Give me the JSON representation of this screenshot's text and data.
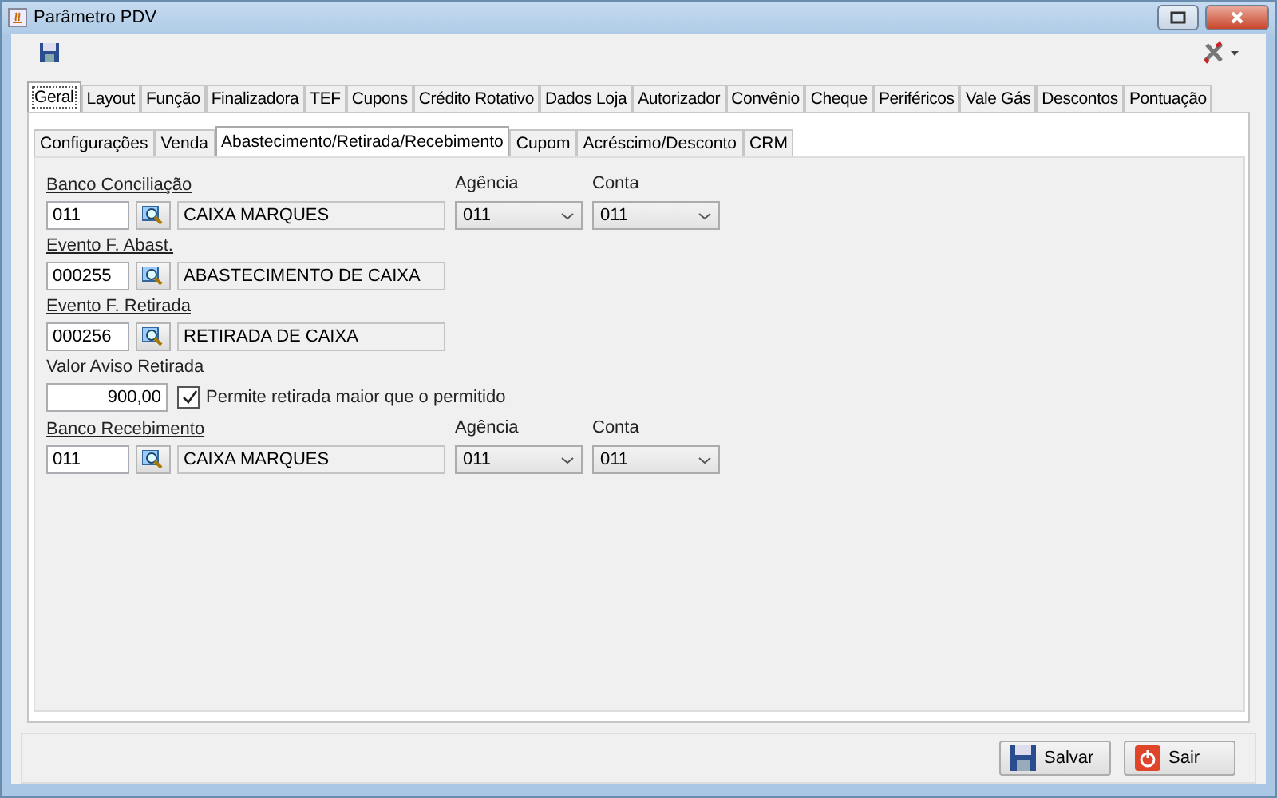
{
  "window": {
    "title": "Parâmetro PDV"
  },
  "main_tabs": [
    {
      "label": "Geral",
      "selected": true
    },
    {
      "label": "Layout",
      "selected": false
    },
    {
      "label": "Função",
      "selected": false
    },
    {
      "label": "Finalizadora",
      "selected": false
    },
    {
      "label": "TEF",
      "selected": false
    },
    {
      "label": "Cupons",
      "selected": false
    },
    {
      "label": "Crédito Rotativo",
      "selected": false
    },
    {
      "label": "Dados Loja",
      "selected": false
    },
    {
      "label": "Autorizador",
      "selected": false
    },
    {
      "label": "Convênio",
      "selected": false
    },
    {
      "label": "Cheque",
      "selected": false
    },
    {
      "label": "Periféricos",
      "selected": false
    },
    {
      "label": "Vale Gás",
      "selected": false
    },
    {
      "label": "Descontos",
      "selected": false
    },
    {
      "label": "Pontuação",
      "selected": false
    }
  ],
  "sub_tabs": [
    {
      "label": "Configurações",
      "selected": false
    },
    {
      "label": "Venda",
      "selected": false
    },
    {
      "label": "Abastecimento/Retirada/Recebimento",
      "selected": true
    },
    {
      "label": "Cupom",
      "selected": false
    },
    {
      "label": "Acréscimo/Desconto",
      "selected": false
    },
    {
      "label": "CRM",
      "selected": false
    }
  ],
  "groups": [
    {
      "kind": "lookup",
      "label": "Banco Conciliação",
      "code": "011",
      "description": "CAIXA MARQUES",
      "agencia": {
        "label": "Agência",
        "value": "011"
      },
      "conta": {
        "label": "Conta",
        "value": "011"
      }
    },
    {
      "kind": "lookup",
      "label": "Evento  F. Abast.",
      "code": "000255",
      "description": "ABASTECIMENTO DE CAIXA"
    },
    {
      "kind": "lookup",
      "label": "Evento F. Retirada",
      "code": "000256",
      "description": "RETIRADA DE CAIXA"
    },
    {
      "kind": "value",
      "label": "Valor Aviso Retirada",
      "value": "900,00",
      "checkbox": {
        "label": "Permite retirada maior que o permitido",
        "checked": true
      }
    },
    {
      "kind": "lookup",
      "label": "Banco Recebimento",
      "code": "011",
      "description": "CAIXA MARQUES",
      "agencia": {
        "label": "Agência",
        "value": "011"
      },
      "conta": {
        "label": "Conta",
        "value": "011"
      }
    }
  ],
  "buttons": [
    {
      "kind": "save",
      "label": "Salvar"
    },
    {
      "kind": "exit",
      "label": "Sair"
    }
  ]
}
